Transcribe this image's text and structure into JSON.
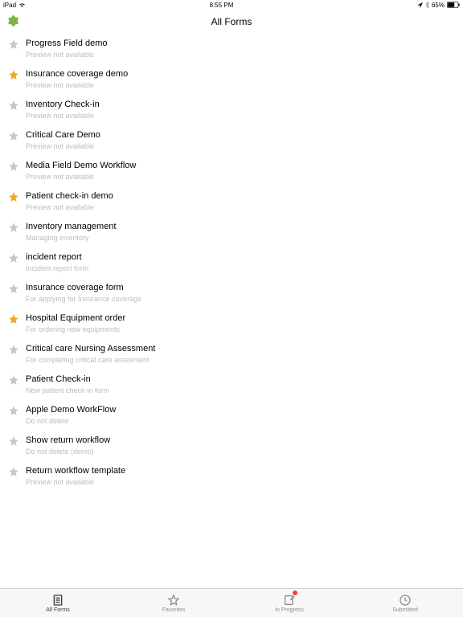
{
  "status": {
    "carrier": "iPad",
    "time": "8:55 PM",
    "battery": "65%"
  },
  "nav": {
    "title": "All Forms"
  },
  "forms": [
    {
      "title": "Progress Field demo",
      "sub": "Preview not available",
      "fav": false
    },
    {
      "title": "Insurance coverage demo",
      "sub": "Preview not available",
      "fav": true
    },
    {
      "title": "Inventory Check-in",
      "sub": "Preview not available",
      "fav": false
    },
    {
      "title": "Critical Care Demo",
      "sub": "Preview not available",
      "fav": false
    },
    {
      "title": "Media Field Demo Workflow",
      "sub": "Preview not available",
      "fav": false
    },
    {
      "title": "Patient check-in demo",
      "sub": "Preview not available",
      "fav": true
    },
    {
      "title": "Inventory management",
      "sub": "Managing inventory",
      "fav": false
    },
    {
      "title": "incident report",
      "sub": "Incident report form",
      "fav": false
    },
    {
      "title": "Insurance coverage form",
      "sub": "For applying for Insurance coverage",
      "fav": false
    },
    {
      "title": "Hospital Equipment order",
      "sub": "For ordering new equipments",
      "fav": true
    },
    {
      "title": "Critical care Nursing Assessment",
      "sub": "For completing critical care assesment",
      "fav": false
    },
    {
      "title": "Patient Check-in",
      "sub": "New patient check-in form",
      "fav": false
    },
    {
      "title": "Apple Demo WorkFlow",
      "sub": "Do not delete",
      "fav": false
    },
    {
      "title": "Show return workflow",
      "sub": "Do not delete (demo)",
      "fav": false
    },
    {
      "title": "Return workflow template",
      "sub": "Preview not available",
      "fav": false
    }
  ],
  "tabs": [
    {
      "label": "All Forms",
      "icon": "list",
      "active": true,
      "badge": false
    },
    {
      "label": "Favorites",
      "icon": "star",
      "active": false,
      "badge": false
    },
    {
      "label": "In Progress",
      "icon": "edit",
      "active": false,
      "badge": true
    },
    {
      "label": "Submitted",
      "icon": "clock",
      "active": false,
      "badge": false
    }
  ],
  "colors": {
    "favStar": "#f5a623",
    "greyStar": "#c7c7c7",
    "gear": "#7cb342"
  }
}
